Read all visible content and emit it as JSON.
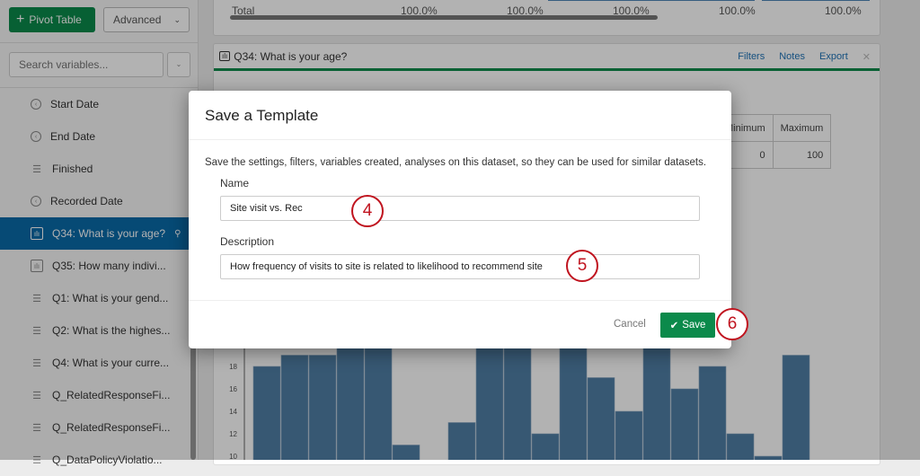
{
  "sidebar": {
    "pivot_button": "Pivot Table",
    "advanced_button": "Advanced",
    "search_placeholder": "Search variables...",
    "items": [
      {
        "label": "Start Date",
        "icon": "clock-icon"
      },
      {
        "label": "End Date",
        "icon": "clock-icon"
      },
      {
        "label": "Finished",
        "icon": "list-icon"
      },
      {
        "label": "Recorded Date",
        "icon": "clock-icon"
      },
      {
        "label": "Q34: What is your age?",
        "icon": "bar-chart-icon",
        "selected": true
      },
      {
        "label": "Q35: How many indivi...",
        "icon": "bar-chart-icon"
      },
      {
        "label": "Q1: What is your gend...",
        "icon": "list-icon"
      },
      {
        "label": "Q2: What is the highes...",
        "icon": "list-icon"
      },
      {
        "label": "Q4: What is your curre...",
        "icon": "list-icon"
      },
      {
        "label": "Q_RelatedResponseFi...",
        "icon": "list-icon"
      },
      {
        "label": "Q_RelatedResponseFi...",
        "icon": "list-icon"
      },
      {
        "label": "Q_DataPolicyViolatio...",
        "icon": "list-icon"
      }
    ]
  },
  "top_table": {
    "total_label": "Total",
    "values": [
      "100.0%",
      "100.0%",
      "100.0%",
      "100.0%",
      "100.0%"
    ]
  },
  "question_card": {
    "title": "Q34: What is your age?",
    "links": [
      "Filters",
      "Notes",
      "Export"
    ],
    "stats": {
      "headers": [
        "Minimum",
        "Maximum"
      ],
      "values": [
        "0",
        "100"
      ]
    }
  },
  "chart_data": {
    "type": "bar",
    "ylim": [
      10,
      20
    ],
    "yticks": [
      "10",
      "12",
      "14",
      "16",
      "18"
    ],
    "values": [
      18,
      19,
      19,
      22,
      22,
      11,
      0,
      13,
      22,
      22,
      12,
      22,
      17,
      14,
      22,
      16,
      18,
      12,
      10,
      19
    ],
    "bar_color": "#4f7ea5"
  },
  "modal": {
    "title": "Save a Template",
    "description": "Save the settings, filters, variables created, analyses on this dataset, so they can be used for similar datasets.",
    "name_label": "Name",
    "name_value": "Site visit vs. Rec",
    "desc_label": "Description",
    "desc_value": "How frequency of visits to site is related to likelihood to recommend site",
    "cancel": "Cancel",
    "save": "Save"
  },
  "annotations": [
    "4",
    "5",
    "6"
  ]
}
